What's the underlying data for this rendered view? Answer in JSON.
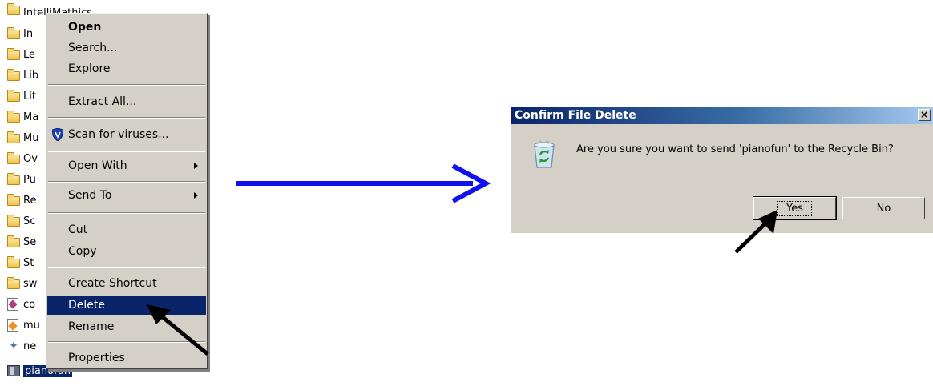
{
  "file_list": [
    {
      "name": "IntelliMathics",
      "icon": "folder-icon"
    },
    {
      "name": "In",
      "icon": "folder-icon"
    },
    {
      "name": "Le",
      "icon": "folder-icon"
    },
    {
      "name": "Lib",
      "icon": "folder-icon"
    },
    {
      "name": "Lit",
      "icon": "folder-icon"
    },
    {
      "name": "Ma",
      "icon": "folder-icon"
    },
    {
      "name": "Mu",
      "icon": "folder-icon"
    },
    {
      "name": "Ov",
      "icon": "folder-icon"
    },
    {
      "name": "Pu",
      "icon": "folder-icon"
    },
    {
      "name": "Re",
      "icon": "folder-icon"
    },
    {
      "name": "Sc",
      "icon": "folder-icon"
    },
    {
      "name": "Se",
      "icon": "folder-icon"
    },
    {
      "name": "St",
      "icon": "folder-icon"
    },
    {
      "name": "sw",
      "icon": "folder-icon"
    },
    {
      "name": "co",
      "icon": "document-icon"
    },
    {
      "name": "mu",
      "icon": "document-icon"
    },
    {
      "name": "ne",
      "icon": "network-icon"
    },
    {
      "name": "pianofun",
      "icon": "package-icon",
      "selected": true
    }
  ],
  "context_menu": {
    "items": [
      {
        "label": "Open",
        "bold": true
      },
      {
        "label": "Search..."
      },
      {
        "label": "Explore"
      },
      {
        "label": "Extract All..."
      },
      {
        "label": "Scan for viruses...",
        "icon": "shield-icon"
      },
      {
        "label": "Open With",
        "submenu": true
      },
      {
        "label": "Send To",
        "submenu": true
      },
      {
        "label": "Cut"
      },
      {
        "label": "Copy"
      },
      {
        "label": "Create Shortcut"
      },
      {
        "label": "Delete",
        "highlighted": true
      },
      {
        "label": "Rename"
      },
      {
        "label": "Properties"
      }
    ]
  },
  "dialog": {
    "title": "Confirm File Delete",
    "close_label": "×",
    "message": "Are you sure you want to send 'pianofun' to the Recycle Bin?",
    "yes_label": "Yes",
    "no_label": "No",
    "icon": "recycle-bin-icon"
  },
  "colors": {
    "window_face": "#d4d0c8",
    "selection": "#0a246a",
    "flow_arrow": "#1010f0",
    "pointer_arrow": "#000000"
  }
}
